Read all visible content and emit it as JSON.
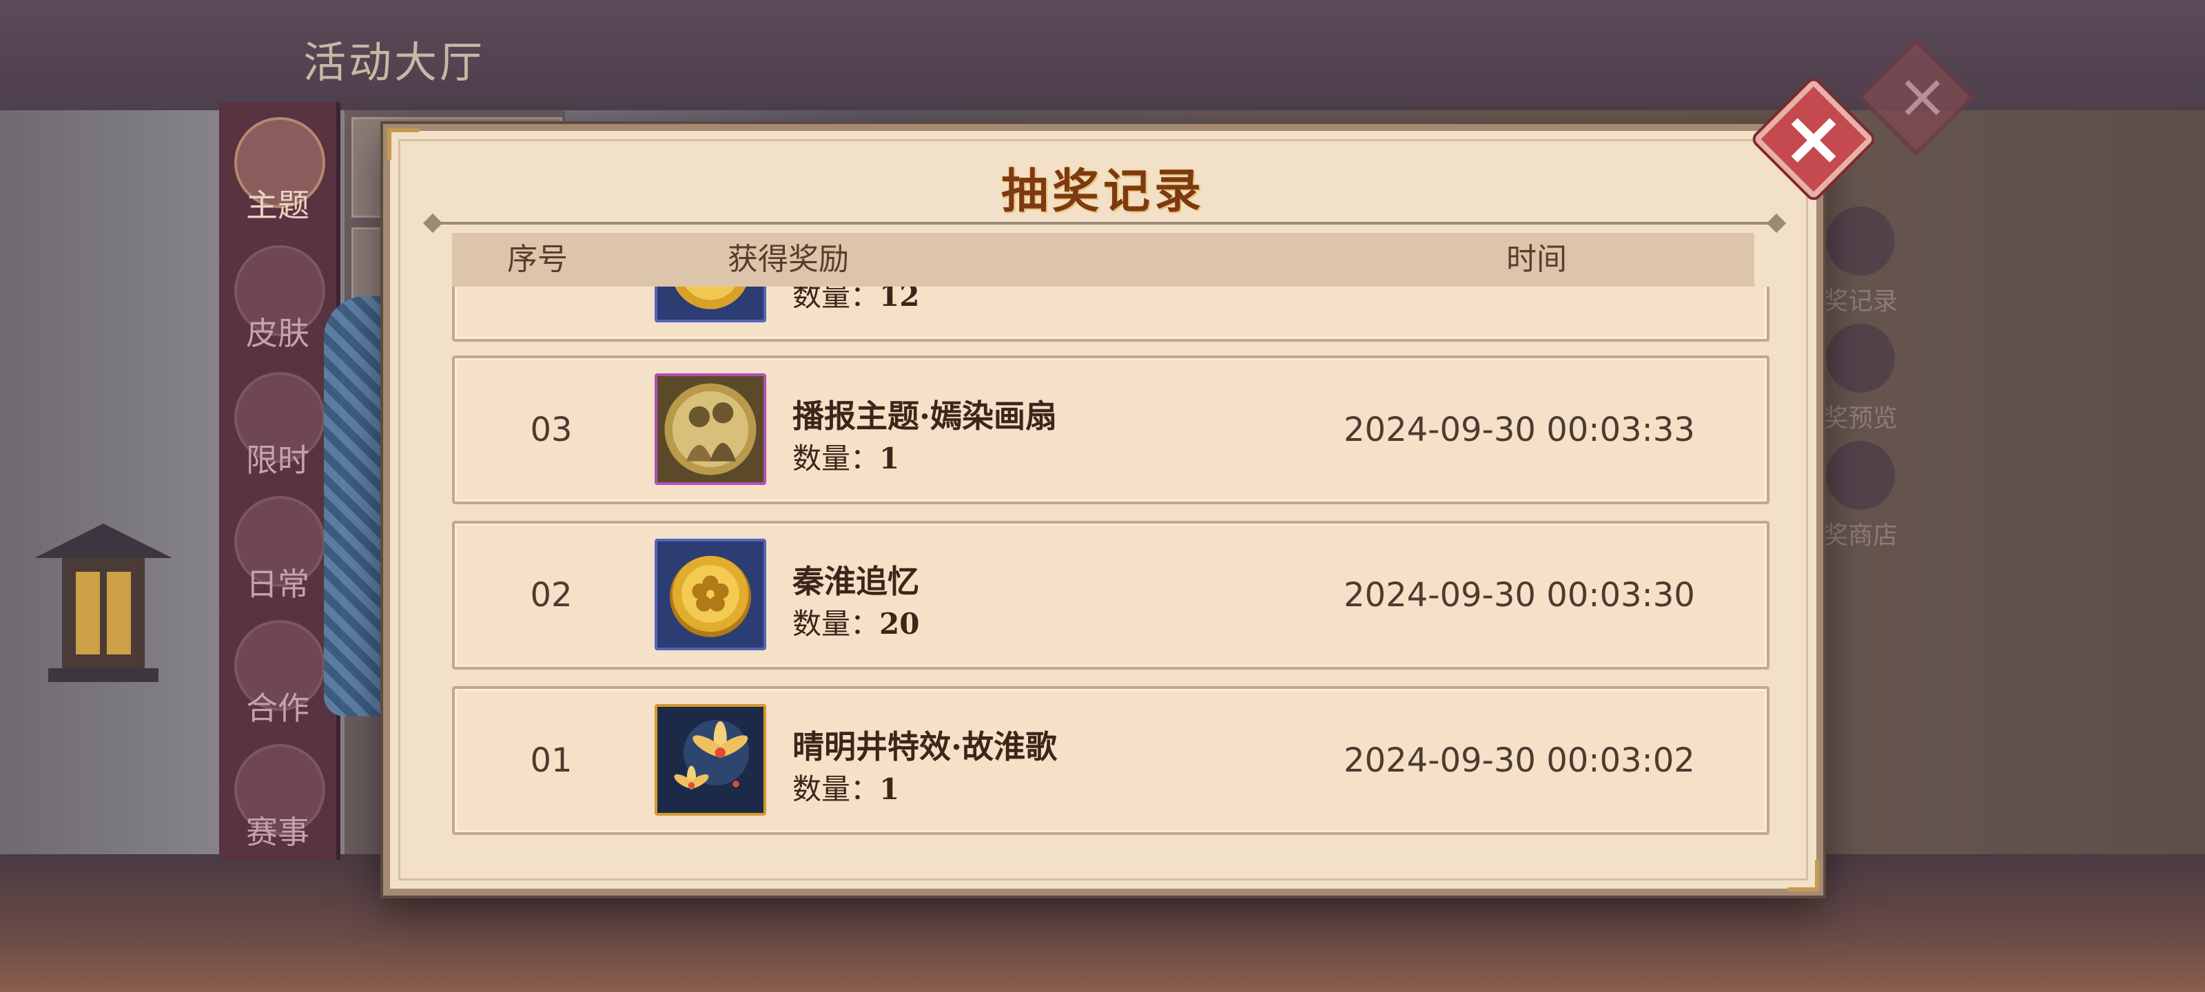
{
  "background": {
    "hall_title": "活动大厅",
    "nav": [
      {
        "label": "主题",
        "icon": "flower-icon",
        "active": true
      },
      {
        "label": "皮肤",
        "icon": "bow-icon",
        "active": false
      },
      {
        "label": "限时",
        "icon": "clock-icon",
        "active": false
      },
      {
        "label": "日常",
        "icon": "gift-icon",
        "active": false
      },
      {
        "label": "合作",
        "icon": "handshake-icon",
        "active": false
      },
      {
        "label": "赛事",
        "icon": "trophy-icon",
        "active": false
      }
    ],
    "right_menu": [
      {
        "label": "奖记录",
        "icon": "cat-icon"
      },
      {
        "label": "奖预览",
        "icon": "scroll-icon"
      },
      {
        "label": "奖商店",
        "icon": "shop-icon"
      }
    ]
  },
  "modal": {
    "title": "抽奖记录",
    "columns": {
      "index": "序号",
      "reward": "获得奖励",
      "time": "时间"
    },
    "qty_prefix": "数量：",
    "partial_row": {
      "qty": "12",
      "icon": "gold-coin-icon"
    },
    "rows": [
      {
        "index": "03",
        "name": "播报主题·嫣染画扇",
        "qty": "1",
        "time": "2024-09-30 00:03:33",
        "icon": "couple-portrait-icon"
      },
      {
        "index": "02",
        "name": "秦淮追忆",
        "qty": "20",
        "time": "2024-09-30 00:03:30",
        "icon": "gold-coin-icon"
      },
      {
        "index": "01",
        "name": "晴明井特效·故淮歌",
        "qty": "1",
        "time": "2024-09-30 00:03:02",
        "icon": "lotus-effect-icon"
      }
    ]
  },
  "colors": {
    "modal_bg": "#f2e1c8",
    "title": "#7c3a12",
    "close_button": "#c44a4f",
    "icon_border_purple": "#b24fb8",
    "icon_border_blue": "#5566b8",
    "icon_border_gold": "#d49a2a"
  }
}
